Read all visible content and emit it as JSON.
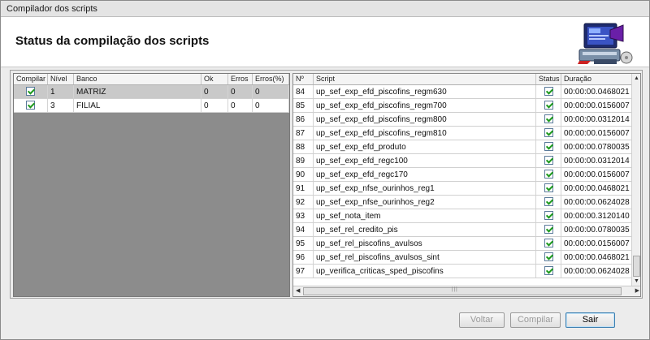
{
  "window": {
    "title": "Compilador dos scripts"
  },
  "header": {
    "title": "Status da compilação dos scripts",
    "icon": "computer-icon"
  },
  "left_grid": {
    "columns": [
      "Compilar",
      "Nível",
      "Banco",
      "Ok",
      "Erros",
      "Erros(%)"
    ],
    "rows": [
      {
        "compilar": true,
        "nivel": "1",
        "banco": "MATRIZ",
        "ok": "0",
        "erros": "0",
        "erros_pct": "0"
      },
      {
        "compilar": true,
        "nivel": "3",
        "banco": "FILIAL",
        "ok": "0",
        "erros": "0",
        "erros_pct": "0"
      }
    ]
  },
  "right_grid": {
    "columns": [
      "Nº",
      "Script",
      "Status",
      "Duração"
    ],
    "rows": [
      {
        "num": "84",
        "script": "up_sef_exp_efd_piscofins_regm630",
        "status": true,
        "duracao": "00:00:00.0468021"
      },
      {
        "num": "85",
        "script": "up_sef_exp_efd_piscofins_regm700",
        "status": true,
        "duracao": "00:00:00.0156007"
      },
      {
        "num": "86",
        "script": "up_sef_exp_efd_piscofins_regm800",
        "status": true,
        "duracao": "00:00:00.0312014"
      },
      {
        "num": "87",
        "script": "up_sef_exp_efd_piscofins_regm810",
        "status": true,
        "duracao": "00:00:00.0156007"
      },
      {
        "num": "88",
        "script": "up_sef_exp_efd_produto",
        "status": true,
        "duracao": "00:00:00.0780035"
      },
      {
        "num": "89",
        "script": "up_sef_exp_efd_regc100",
        "status": true,
        "duracao": "00:00:00.0312014"
      },
      {
        "num": "90",
        "script": "up_sef_exp_efd_regc170",
        "status": true,
        "duracao": "00:00:00.0156007"
      },
      {
        "num": "91",
        "script": "up_sef_exp_nfse_ourinhos_reg1",
        "status": true,
        "duracao": "00:00:00.0468021"
      },
      {
        "num": "92",
        "script": "up_sef_exp_nfse_ourinhos_reg2",
        "status": true,
        "duracao": "00:00:00.0624028"
      },
      {
        "num": "93",
        "script": "up_sef_nota_item",
        "status": true,
        "duracao": "00:00:00.3120140"
      },
      {
        "num": "94",
        "script": "up_sef_rel_credito_pis",
        "status": true,
        "duracao": "00:00:00.0780035"
      },
      {
        "num": "95",
        "script": "up_sef_rel_piscofins_avulsos",
        "status": true,
        "duracao": "00:00:00.0156007"
      },
      {
        "num": "96",
        "script": "up_sef_rel_piscofins_avulsos_sint",
        "status": true,
        "duracao": "00:00:00.0468021"
      },
      {
        "num": "97",
        "script": "up_verifica_criticas_sped_piscofins",
        "status": true,
        "duracao": "00:00:00.0624028"
      }
    ]
  },
  "buttons": {
    "voltar": "Voltar",
    "compilar": "Compilar",
    "sair": "Sair"
  },
  "colors": {
    "check": "#1e9a1e",
    "selected_row": "#c9c9c9",
    "grid_empty": "#8c8c8c",
    "primary_border": "#3c7fb1"
  }
}
